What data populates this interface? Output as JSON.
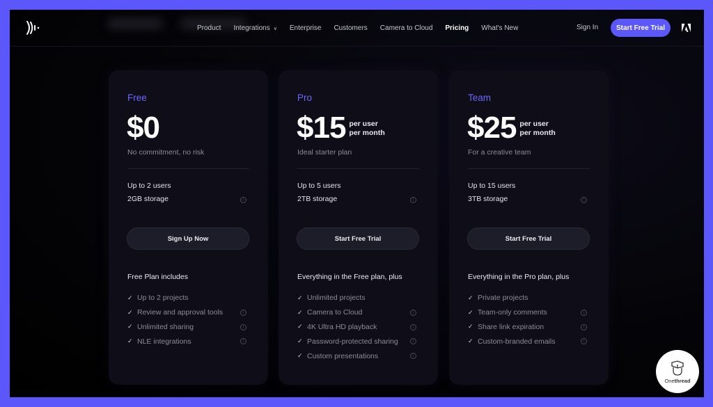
{
  "nav": {
    "logo_icon": "frameio-logo-icon",
    "links": [
      {
        "label": "Product",
        "active": false
      },
      {
        "label": "Integrations",
        "active": false,
        "dropdown": true
      },
      {
        "label": "Enterprise",
        "active": false
      },
      {
        "label": "Customers",
        "active": false
      },
      {
        "label": "Camera to Cloud",
        "active": false
      },
      {
        "label": "Pricing",
        "active": true
      },
      {
        "label": "What's New",
        "active": false
      }
    ],
    "sign_in": "Sign In",
    "cta": "Start Free Trial",
    "adobe_icon": "adobe-logo-icon"
  },
  "colors": {
    "accent": "#5b57fb",
    "plan_name": "#6a66ff",
    "background": "#000000",
    "card": "#0f0e18"
  },
  "plans": [
    {
      "name": "Free",
      "price": "$0",
      "unit_line1": "",
      "unit_line2": "",
      "tagline": "No commitment, no risk",
      "users": "Up to 2 users",
      "storage": "2GB storage",
      "button": "Sign Up Now",
      "includes_title": "Free Plan includes",
      "features": [
        {
          "text": "Up to 2 projects",
          "info": false
        },
        {
          "text": "Review and approval tools",
          "info": true
        },
        {
          "text": "Unlimited sharing",
          "info": true
        },
        {
          "text": "NLE integrations",
          "info": true
        }
      ]
    },
    {
      "name": "Pro",
      "price": "$15",
      "unit_line1": "per user",
      "unit_line2": "per month",
      "tagline": "Ideal starter plan",
      "users": "Up to 5 users",
      "storage": "2TB storage",
      "button": "Start Free Trial",
      "includes_title": "Everything in the Free plan, plus",
      "features": [
        {
          "text": "Unlimited projects",
          "info": false
        },
        {
          "text": "Camera to Cloud",
          "info": true
        },
        {
          "text": "4K Ultra HD playback",
          "info": true
        },
        {
          "text": "Password-protected sharing",
          "info": true
        },
        {
          "text": "Custom presentations",
          "info": true
        }
      ]
    },
    {
      "name": "Team",
      "price": "$25",
      "unit_line1": "per user",
      "unit_line2": "per month",
      "tagline": "For a creative team",
      "users": "Up to 15 users",
      "storage": "3TB storage",
      "button": "Start Free Trial",
      "includes_title": "Everything in the Pro plan, plus",
      "features": [
        {
          "text": "Private projects",
          "info": false
        },
        {
          "text": "Team-only comments",
          "info": true
        },
        {
          "text": "Share link expiration",
          "info": true
        },
        {
          "text": "Custom-branded emails",
          "info": true
        }
      ]
    }
  ],
  "icons": {
    "check": "✓",
    "info": "i",
    "chevron": "⌄"
  },
  "watermark": {
    "text_light": "One",
    "text_bold": "thread"
  }
}
